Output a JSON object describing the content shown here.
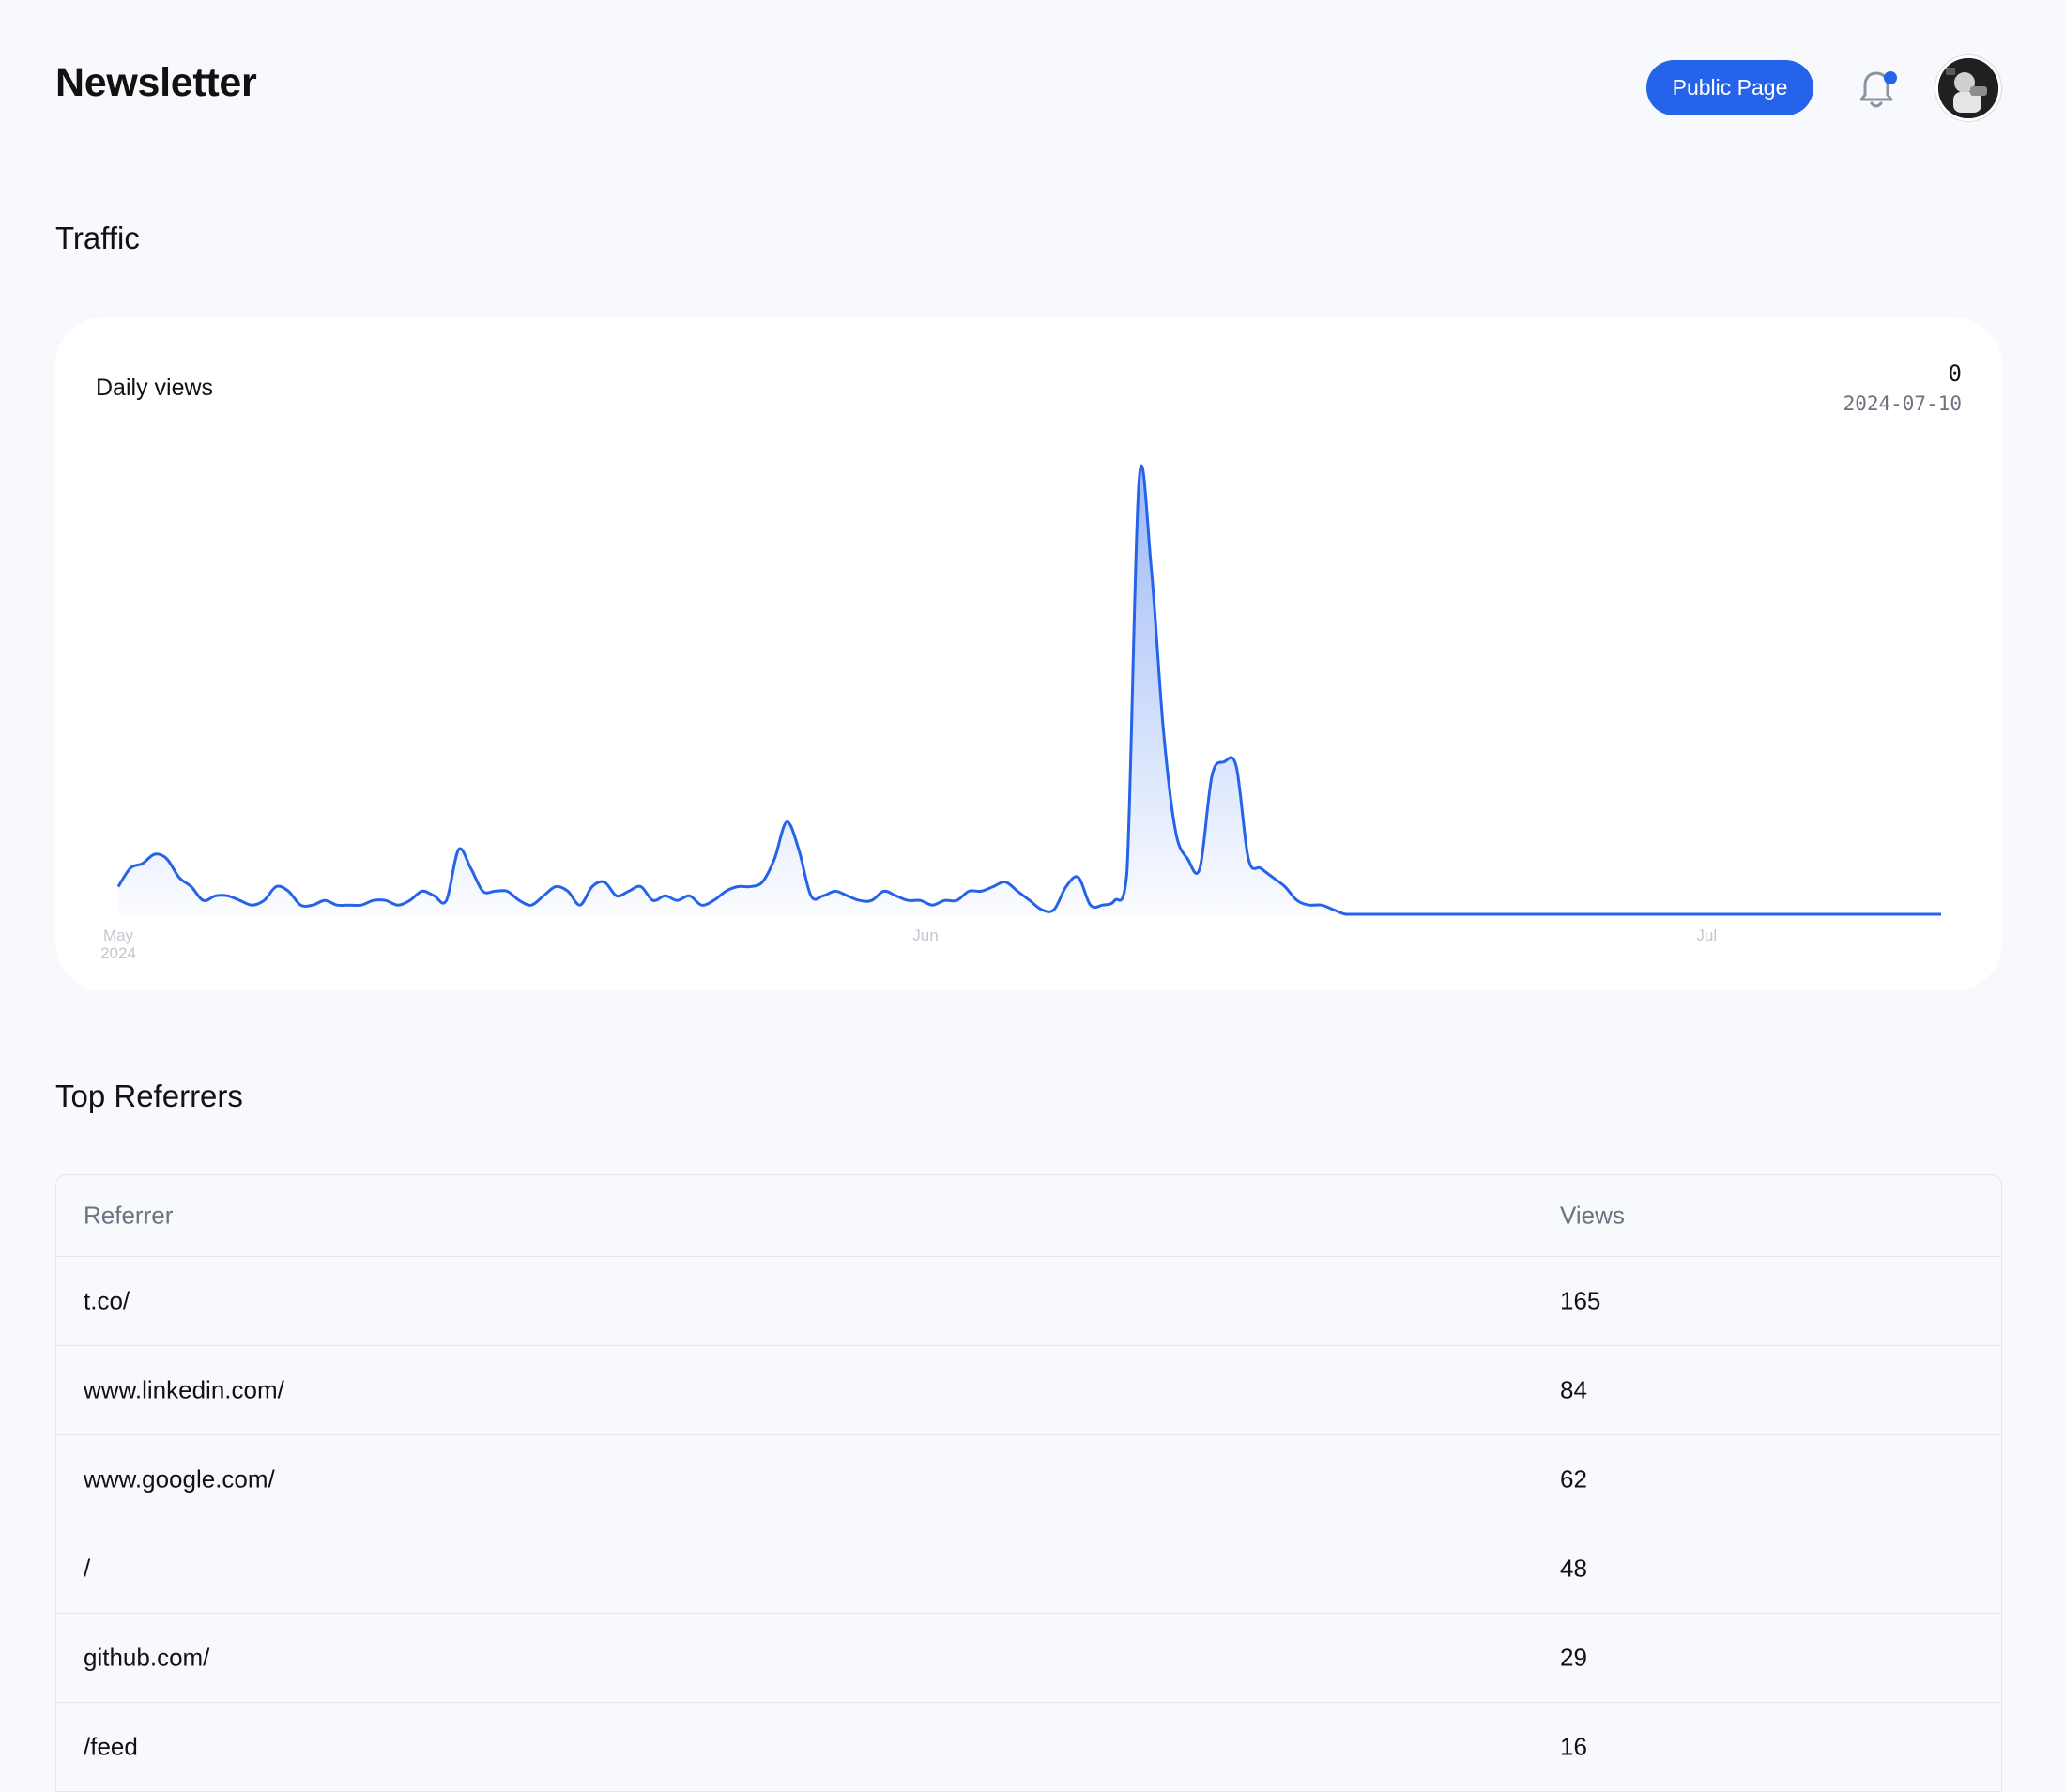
{
  "header": {
    "title": "Newsletter",
    "public_page_label": "Public Page",
    "has_notification": true,
    "accent_color": "#2563eb"
  },
  "traffic": {
    "section_title": "Traffic",
    "chart_title": "Daily views",
    "readout_value": "0",
    "readout_date": "2024-07-10"
  },
  "chart_data": {
    "type": "area",
    "title": "Daily views",
    "series": [
      {
        "values": [
          6,
          10,
          11,
          13,
          12,
          8,
          6,
          3,
          4,
          4,
          3,
          2,
          3,
          6,
          5,
          2,
          2,
          3,
          2,
          2,
          2,
          3,
          3,
          2,
          3,
          5,
          4,
          3,
          14,
          10,
          5,
          5,
          5,
          3,
          2,
          4,
          6,
          5,
          2,
          6,
          7,
          4,
          5,
          6,
          3,
          4,
          3,
          4,
          2,
          3,
          5,
          6,
          6,
          7,
          12,
          20,
          14,
          4,
          4,
          5,
          4,
          3,
          3,
          5,
          4,
          3,
          3,
          2,
          3,
          3,
          5,
          5,
          6,
          7,
          5,
          3,
          1,
          1,
          6,
          8,
          2,
          2,
          3,
          9,
          94,
          75,
          40,
          18,
          12,
          10,
          30,
          33,
          32,
          12,
          10,
          8,
          6,
          3,
          2,
          2,
          1,
          0,
          0,
          0,
          0,
          0,
          0,
          0,
          0,
          0,
          0,
          0,
          0,
          0,
          0,
          0,
          0,
          0,
          0,
          0,
          0,
          0,
          0,
          0,
          0,
          0,
          0,
          0,
          0,
          0,
          0,
          0,
          0,
          0,
          0,
          0,
          0,
          0,
          0,
          0,
          0,
          0,
          0,
          0,
          0,
          0,
          0,
          0,
          0,
          0,
          0
        ]
      }
    ],
    "x_start": "2024-05-01",
    "x_end": "2024-07-10",
    "x_ticks": [
      {
        "label": "May",
        "sublabel": "2024",
        "date": "2024-05-01"
      },
      {
        "label": "Jun",
        "sublabel": "",
        "date": "2024-06-01"
      },
      {
        "label": "Jul",
        "sublabel": "",
        "date": "2024-07-01"
      }
    ],
    "ylim": [
      0,
      100
    ],
    "grid": false,
    "line_color": "#2563eb"
  },
  "referrers": {
    "section_title": "Top Referrers",
    "columns": [
      "Referrer",
      "Views"
    ],
    "rows": [
      {
        "referrer": "t.co/",
        "views": "165"
      },
      {
        "referrer": "www.linkedin.com/",
        "views": "84"
      },
      {
        "referrer": "www.google.com/",
        "views": "62"
      },
      {
        "referrer": "/",
        "views": "48"
      },
      {
        "referrer": "github.com/",
        "views": "29"
      },
      {
        "referrer": "/feed",
        "views": "16"
      }
    ]
  }
}
